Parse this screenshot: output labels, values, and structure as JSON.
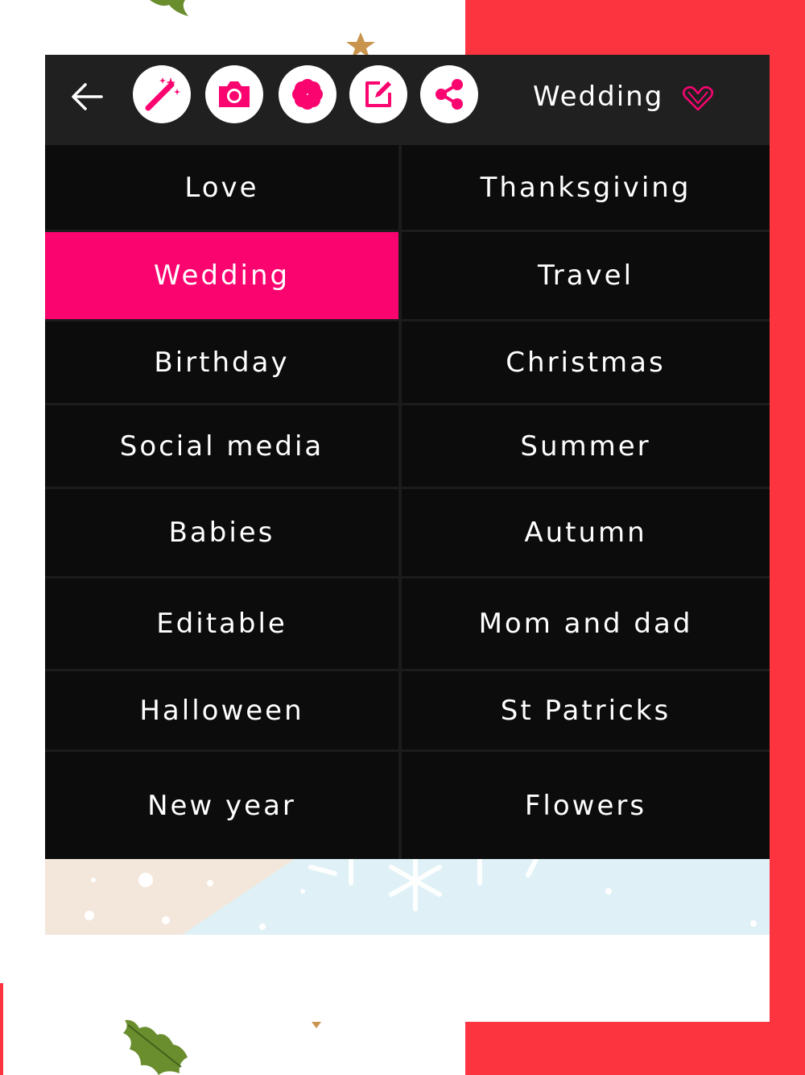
{
  "toolbar": {
    "buttons": [
      {
        "name": "magic-wand",
        "icon": "magic-wand-icon"
      },
      {
        "name": "camera",
        "icon": "camera-icon"
      },
      {
        "name": "flower",
        "icon": "flower-icon"
      },
      {
        "name": "edit",
        "icon": "edit-icon"
      },
      {
        "name": "share",
        "icon": "share-icon"
      }
    ],
    "title": "Wedding",
    "back_icon": "arrow-left-icon",
    "heart_icon": "heart-outline-icon"
  },
  "categories": {
    "left": [
      "Love",
      "Wedding",
      "Birthday",
      "Social media",
      "Babies",
      "Editable",
      "Halloween",
      "New year"
    ],
    "right": [
      "Thanksgiving",
      "Travel",
      "Christmas",
      "Summer",
      "Autumn",
      "Mom and dad",
      "St Patricks",
      "Flowers"
    ],
    "selected": "Wedding"
  },
  "colors": {
    "accent": "#fa0470",
    "panel": "#0c0c0d",
    "toolbar": "#202021",
    "background_red": "#fc3440"
  }
}
